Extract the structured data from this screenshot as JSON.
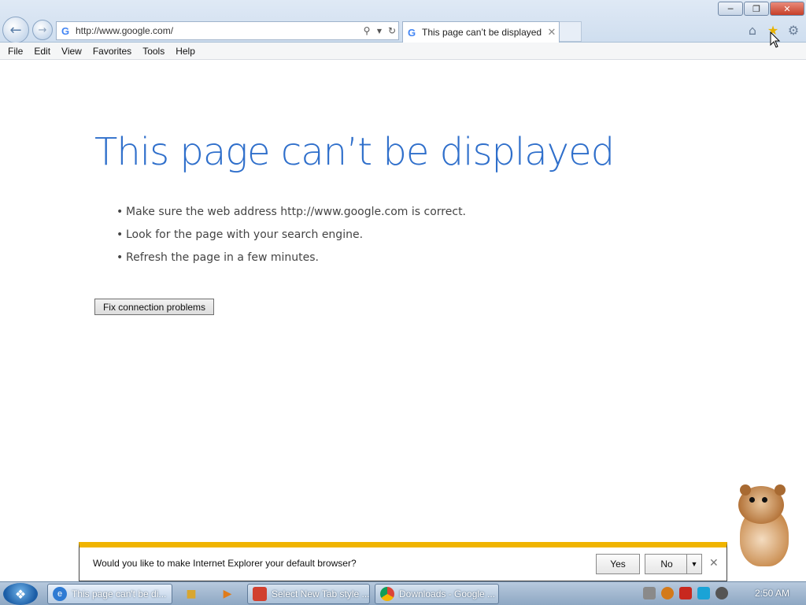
{
  "browser": {
    "address_url": "http://www.google.com/",
    "tab_title": "This page can’t be displayed",
    "icons": [
      "back-icon",
      "forward-icon",
      "search-icon",
      "refresh-icon",
      "home-icon",
      "favorites-star-icon",
      "settings-gear-icon"
    ]
  },
  "menubar": {
    "items": [
      "File",
      "Edit",
      "View",
      "Favorites",
      "Tools",
      "Help"
    ]
  },
  "page": {
    "heading": "This page can’t be displayed",
    "tips": [
      "Make sure the web address http://www.google.com is correct.",
      "Look for the page with your search engine.",
      "Refresh the page in a few minutes."
    ],
    "fix_button": "Fix connection problems"
  },
  "notification": {
    "message": "Would you like to make Internet Explorer your default browser?",
    "yes_label": "Yes",
    "no_label": "No"
  },
  "taskbar": {
    "items": [
      "This page can't be di...",
      "Select New Tab style ...",
      "Downloads - Google ..."
    ],
    "clock": "2:50 AM"
  },
  "colors": {
    "heading_blue": "#2f6fcb",
    "notification_accent": "#f0b400"
  }
}
